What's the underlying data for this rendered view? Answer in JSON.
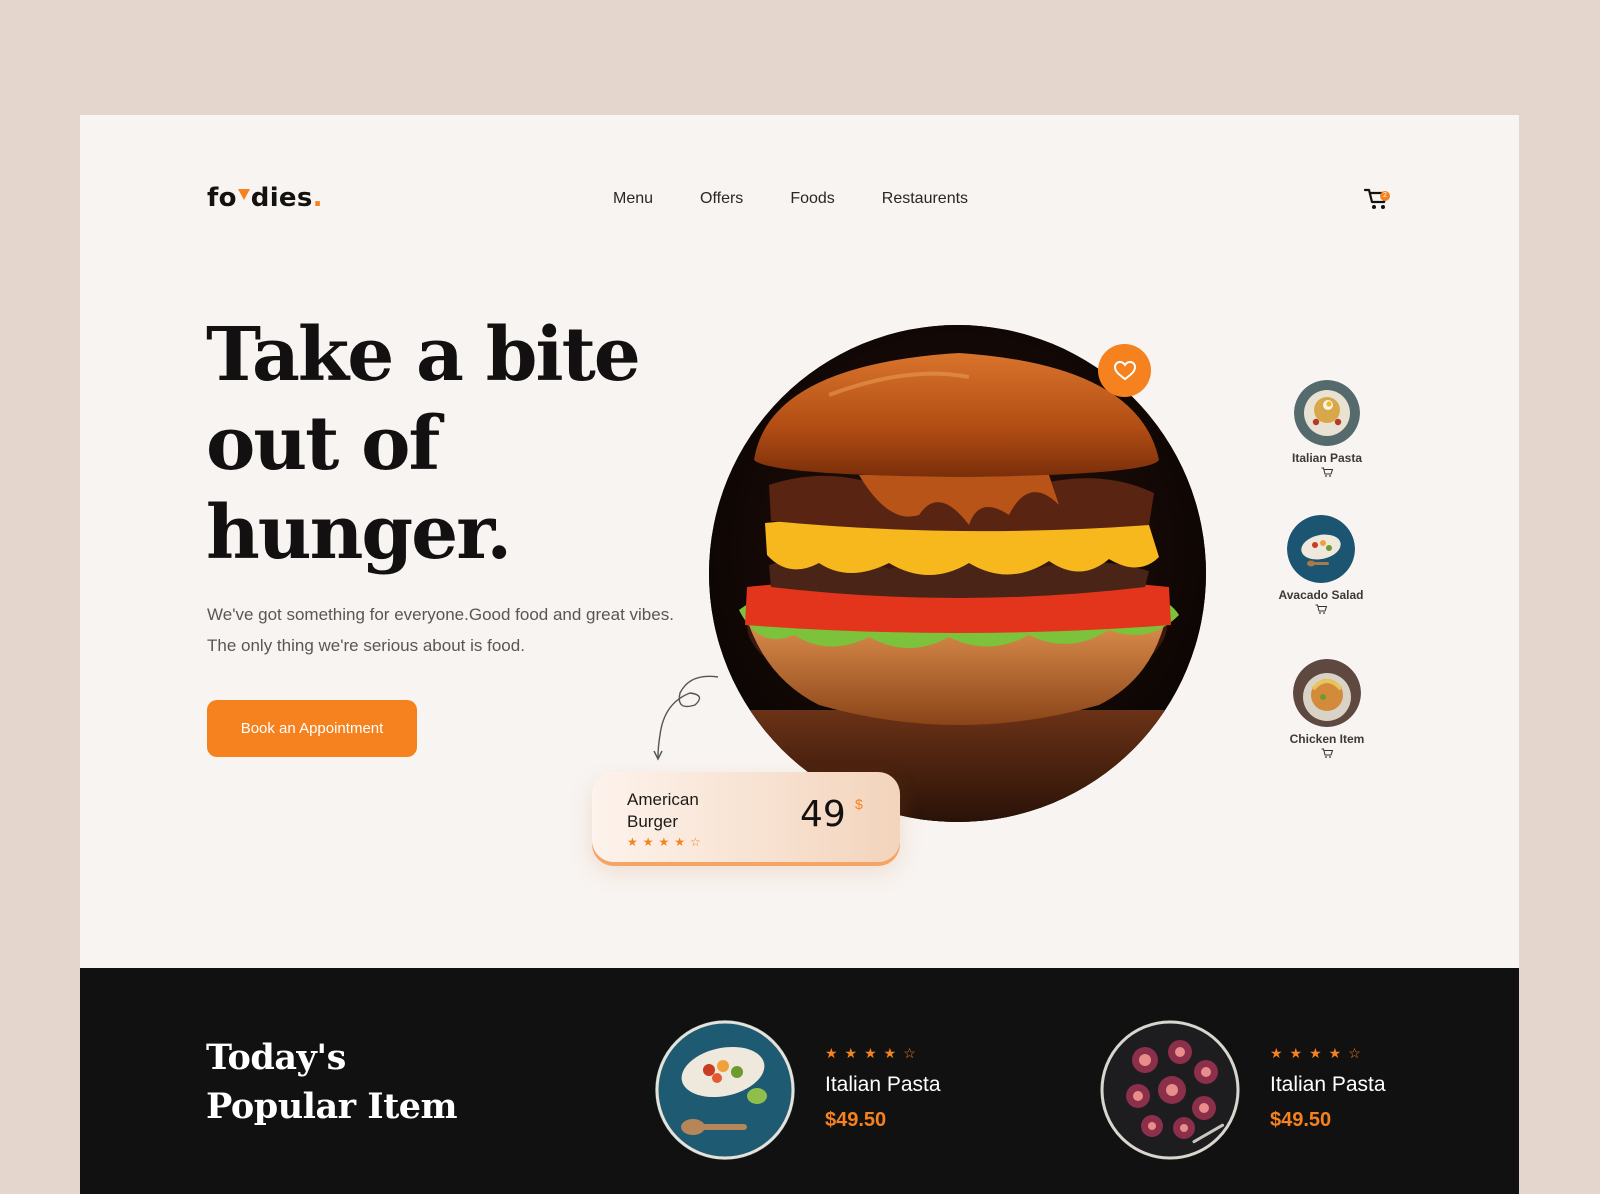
{
  "brand": {
    "logo_start": "fo",
    "logo_end": "dies",
    "logo_dot": "."
  },
  "nav": {
    "items": [
      {
        "label": "Menu"
      },
      {
        "label": "Offers"
      },
      {
        "label": "Foods"
      },
      {
        "label": "Restaurents"
      }
    ],
    "cart_count": "2"
  },
  "hero": {
    "title_line1": "Take a bite",
    "title_line2": "out of",
    "title_line3": "hunger.",
    "subtitle_line1": "We've got something for everyone.Good food and great vibes.",
    "subtitle_line2": "The only thing we're serious about is food.",
    "cta_label": "Book an Appointment"
  },
  "featured": {
    "name": "American Burger",
    "rating": 4,
    "rating_max": 5,
    "price": "49",
    "currency": "$"
  },
  "side_items": [
    {
      "name": "Italian Pasta"
    },
    {
      "name": "Avacado Salad"
    },
    {
      "name": "Chicken Item"
    }
  ],
  "popular": {
    "title_line1": "Today's",
    "title_line2": "Popular Item",
    "items": [
      {
        "name": "Italian Pasta",
        "price": "$49.50",
        "rating": 4,
        "rating_max": 5
      },
      {
        "name": "Italian Pasta",
        "price": "$49.50",
        "rating": 4,
        "rating_max": 5
      }
    ]
  },
  "colors": {
    "accent": "#f5821f",
    "page_bg": "#e4d6cd",
    "card_bg": "#f8f4f1",
    "dark": "#121111"
  }
}
